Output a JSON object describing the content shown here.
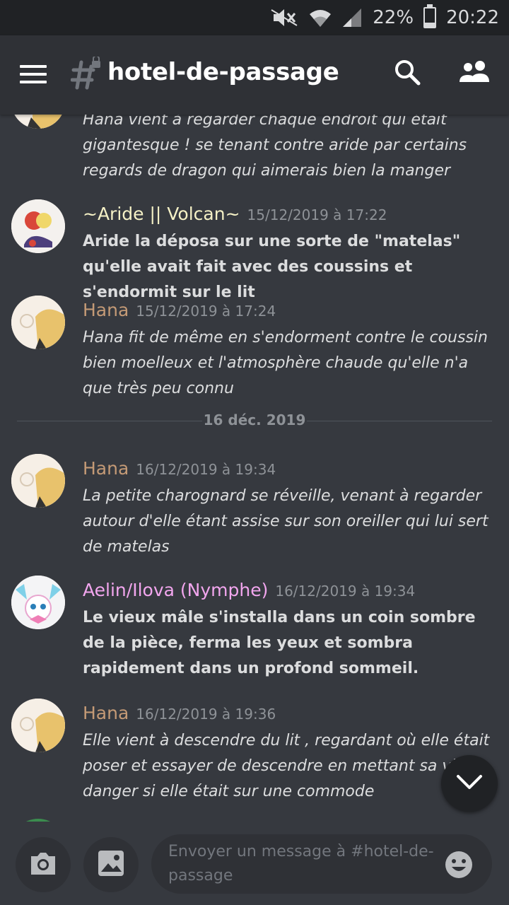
{
  "status_bar": {
    "battery": "22%",
    "battery_level": 0.22,
    "time": "20:22",
    "icons": [
      "mute-icon",
      "wifi-icon",
      "signal-icon",
      "battery-icon"
    ]
  },
  "header": {
    "channel_name": "hotel-de-passage",
    "icons": [
      "menu-icon",
      "hash-lock-icon",
      "search-icon",
      "members-icon"
    ]
  },
  "messages": [
    {
      "author": "",
      "timestamp": "",
      "text": "Hana vient à regarder chaque endroit qui était gigantesque ! se tenant contre aride par certains regards de dragon qui aimerais bien la manger",
      "style": "italic"
    },
    {
      "author": "~Aride || Volcan~",
      "author_color": "#f5f1c6",
      "timestamp": "15/12/2019 à 17:22",
      "text": "Aride la déposa sur une sorte de \"matelas\" qu'elle avait fait avec des coussins et s'endormit sur le lit",
      "style": "bold"
    },
    {
      "author": "Hana",
      "author_color": "#c49a76",
      "timestamp": "15/12/2019 à 17:24",
      "text": "Hana fit de même en s'endorment contre le coussin bien moelleux et l'atmosphère chaude qu'elle n'a que très peu connu",
      "style": "italic"
    },
    {
      "author": "Hana",
      "author_color": "#c49a76",
      "timestamp": "16/12/2019 à 19:34",
      "text": "La petite charognard se réveille,  venant à regarder autour d'elle étant assise sur son oreiller qui lui sert de matelas",
      "style": "italic"
    },
    {
      "author": "Aelin/Ilova (Nymphe)",
      "author_color": "#f2a6ee",
      "timestamp": "16/12/2019 à 19:34",
      "text": "Le vieux mâle s'installa dans un coin sombre de la pièce, ferma les yeux et sombra rapidement dans un profond sommeil.",
      "style": "bold"
    },
    {
      "author": "Hana",
      "author_color": "#c49a76",
      "timestamp": "16/12/2019 à 19:36",
      "text": "Elle vient à descendre du lit , regardant où elle était poser et essayer de descendre en mettant sa vie en danger si elle était sur une commode",
      "style": "italic"
    }
  ],
  "date_divider": "16 déc. 2019",
  "composer": {
    "placeholder": "Envoyer un message à #hotel-de-passage",
    "icons": [
      "camera-icon",
      "image-icon",
      "emoji-icon"
    ]
  },
  "scroll_button_icon": "chevron-down-icon"
}
